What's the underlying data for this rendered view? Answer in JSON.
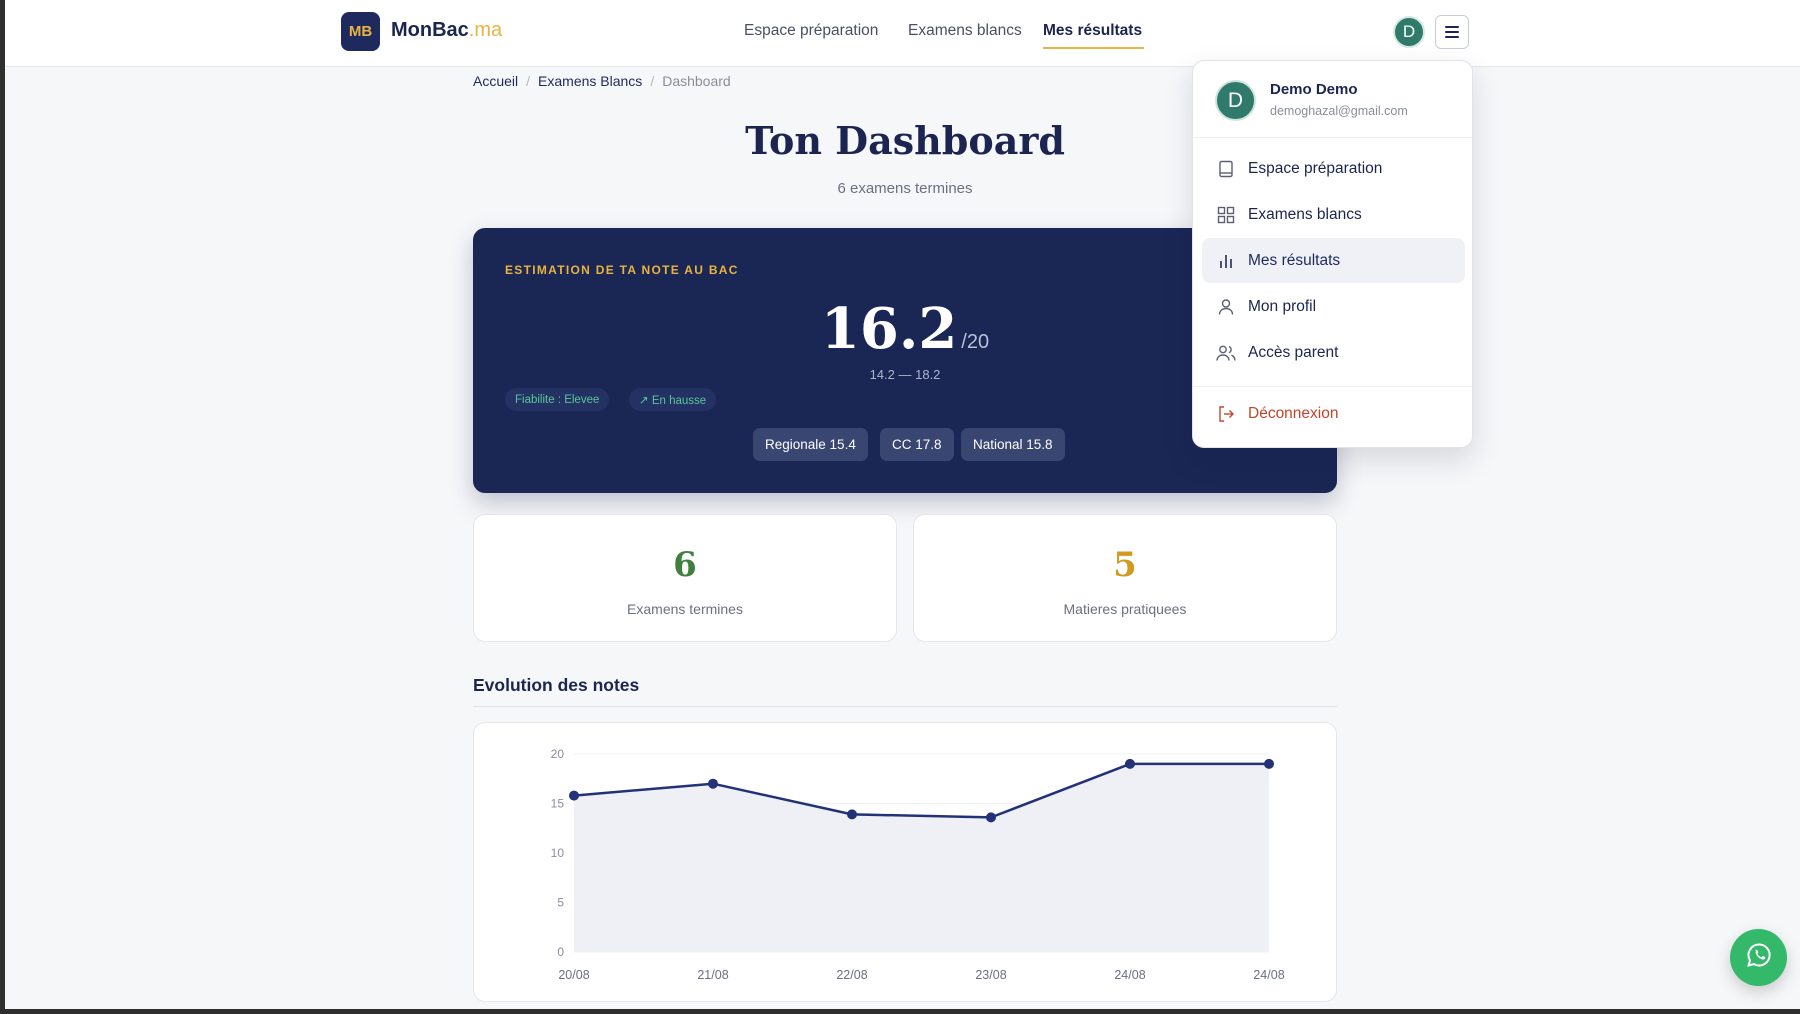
{
  "brand": {
    "badge": "MB",
    "name": "MonBac",
    "tld": ".ma"
  },
  "nav": [
    {
      "label": "Espace préparation"
    },
    {
      "label": "Examens blancs"
    },
    {
      "label": "Mes résultats",
      "active": true
    }
  ],
  "user": {
    "initial": "D",
    "name": "Demo Demo",
    "email": "demoghazal@gmail.com"
  },
  "breadcrumb": {
    "home": "Accueil",
    "section": "Examens Blancs",
    "current": "Dashboard",
    "separator": "/"
  },
  "page": {
    "title": "Ton Dashboard",
    "subtitle": "6 examens termines"
  },
  "estimate": {
    "kicker": "ESTIMATION DE TA NOTE AU BAC",
    "score": "16.2",
    "max": "/20",
    "range": "14.2 — 18.2",
    "chips": [
      "Fiabilite : Elevee",
      "↗ En hausse"
    ],
    "breakdown": [
      "Regionale 15.4",
      "CC 17.8",
      "National 15.8"
    ]
  },
  "stats": [
    {
      "value": "6",
      "label": "Examens termines",
      "color": "#3f7f3f"
    },
    {
      "value": "5",
      "label": "Matieres pratiquees",
      "color": "#d39a22"
    }
  ],
  "evolution": {
    "title": "Evolution des notes"
  },
  "chart_data": {
    "type": "area",
    "categories": [
      "20/08",
      "21/08",
      "22/08",
      "23/08",
      "24/08",
      "24/08"
    ],
    "series": [
      {
        "values": [
          15.8,
          17.0,
          13.9,
          13.6,
          19.0,
          19.0
        ]
      }
    ],
    "yticks": [
      0,
      5,
      10,
      15,
      20
    ],
    "ylim": [
      0,
      20
    ],
    "color": "#233276",
    "fill": "#eef0f5"
  },
  "menu": {
    "items": [
      {
        "label": "Espace préparation",
        "icon": "book-icon"
      },
      {
        "label": "Examens blancs",
        "icon": "grid-icon"
      },
      {
        "label": "Mes résultats",
        "icon": "bar-chart-icon",
        "active": true
      },
      {
        "label": "Mon profil",
        "icon": "user-icon"
      },
      {
        "label": "Accès parent",
        "icon": "users-icon"
      }
    ],
    "logout": {
      "label": "Déconnexion",
      "icon": "logout-icon",
      "color": "#c0462a"
    }
  },
  "colors": {
    "navy": "#1a2654",
    "gold": "#e9b341",
    "green": "#59c69a",
    "whatsapp": "#34b86a"
  }
}
